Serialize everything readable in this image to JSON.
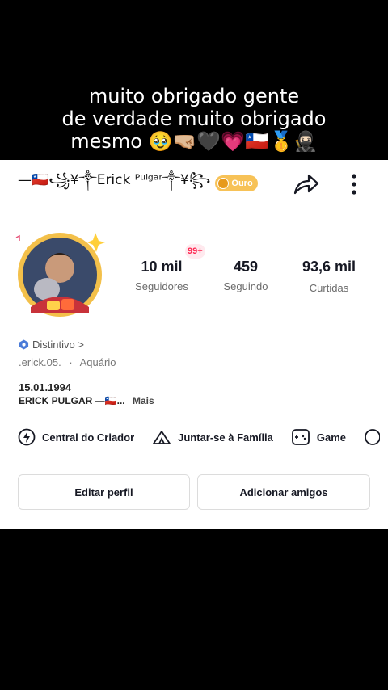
{
  "caption": {
    "line1": "muito obrigado gente",
    "line2": "de verdade muito obrigado",
    "line3": "mesmo 🥹🤜🏼🖤💗🇨🇱🥇🥷🏻"
  },
  "profile": {
    "display_name": "—🇨🇱꧁¥༒Erick ᴾᵘˡᵍᵃʳ༒¥꧂",
    "level_badge": "Ouro",
    "username": ".erick.05.",
    "separator": "·",
    "sign": "Aquário",
    "distintivo_label": "Distintivo >",
    "bio_line1": "15.01.1994",
    "bio_line2": "ERICK PULGAR —🇨🇱...",
    "bio_more": "Mais"
  },
  "stats": {
    "followers": {
      "value": "10 mil",
      "label": "Seguidores",
      "badge": "99+"
    },
    "following": {
      "value": "459",
      "label": "Seguindo"
    },
    "likes": {
      "value": "93,6 mil",
      "label": "Curtidas"
    }
  },
  "links": {
    "creator_center": "Central do Criador",
    "join_family": "Juntar-se à Família",
    "game": "Game"
  },
  "buttons": {
    "edit_profile": "Editar perfil",
    "add_friends": "Adicionar amigos"
  },
  "colors": {
    "accent_red": "#fe2c55",
    "ouro_badge": "#f7c257",
    "distintivo_blue": "#4a7bd8"
  },
  "icons": {
    "share": "share-arrow-icon",
    "more": "more-vertical-icon",
    "creator": "lightning-circle-icon",
    "family": "tent-icon",
    "game": "gamepad-icon"
  }
}
